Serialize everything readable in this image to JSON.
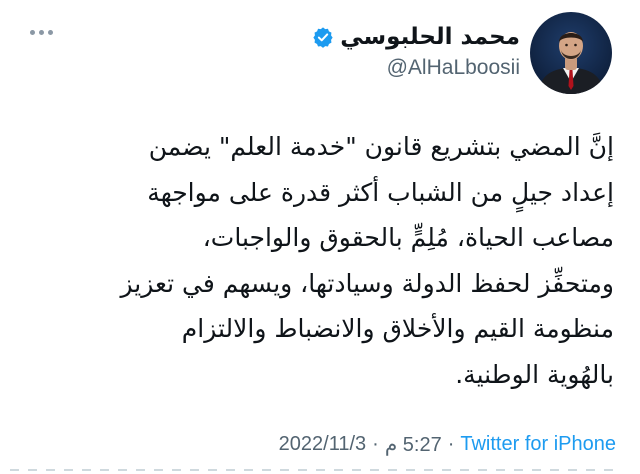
{
  "author": {
    "display_name": "محمد الحلبوسي",
    "handle": "@AlHaLboosii",
    "verified": true,
    "verified_icon": "verified-badge-icon",
    "avatar_icon": "avatar"
  },
  "more_icon": "more-options-icon",
  "tweet": {
    "text": "إنَّ المضي بتشريع قانون \"خدمة العلم\" يضمن\nإعداد جيلٍ من الشباب أكثر قدرة على مواجهة\nمصاعب الحياة، مُلِمٍّ بالحقوق والواجبات،\nومتحفِّز لحفظ الدولة وسيادتها، ويسهم في تعزيز\nمنظومة القيم والأخلاق والانضباط والالتزام\nبالهُوية الوطنية."
  },
  "meta": {
    "date": "2022/11/3",
    "separator": "·",
    "time": "5:27 م",
    "source": "Twitter for iPhone"
  },
  "colors": {
    "accent": "#1d9bf0",
    "text": "#0f1419",
    "secondary": "#536471"
  }
}
